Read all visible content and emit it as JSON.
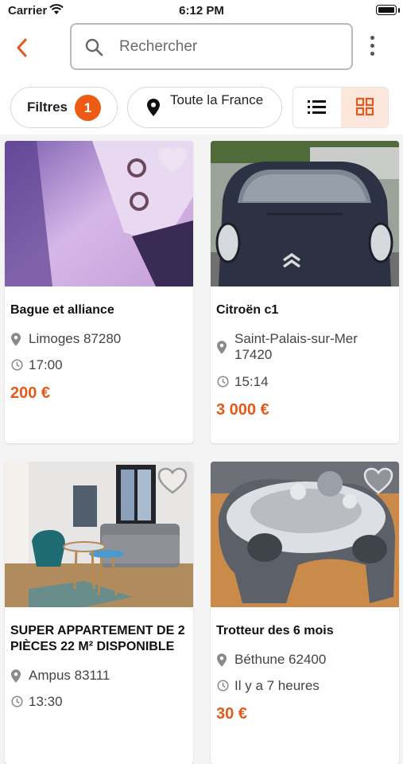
{
  "status_bar": {
    "carrier": "Carrier",
    "time": "6:12 PM"
  },
  "header": {
    "search_placeholder": "Rechercher"
  },
  "filters": {
    "filters_label": "Filtres",
    "filters_count": "1",
    "location_label": "Toute la France",
    "view_mode": "grid"
  },
  "colors": {
    "accent": "#ec5a13",
    "price": "#e55a1b",
    "grid_active_bg": "#fde6dc"
  },
  "listings": [
    {
      "title": "Bague et alliance",
      "location": "Limoges 87280",
      "time": "17:00",
      "price": "200 €",
      "image": "ring-photo"
    },
    {
      "title": "Citroën c1",
      "location": "Saint-Palais-sur-Mer 17420",
      "time": "15:14",
      "price": "3 000 €",
      "image": "car-photo"
    },
    {
      "title": "SUPER APPARTEMENT DE 2 PIÈCES 22 M² DISPONIBLE",
      "location": "Ampus 83111",
      "time": "13:30",
      "price": "",
      "image": "apartment-photo"
    },
    {
      "title": "Trotteur des 6 mois",
      "location": "Béthune 62400",
      "time": "Il y a 7 heures",
      "price": "30 €",
      "image": "baby-walker-photo"
    }
  ]
}
